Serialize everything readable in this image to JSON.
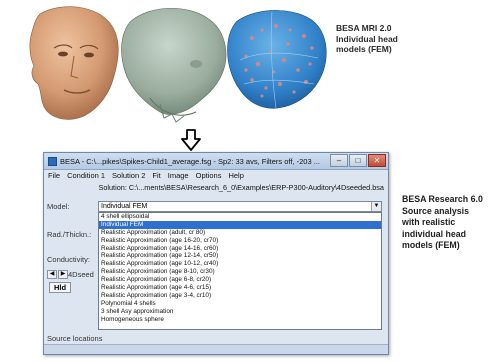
{
  "top_caption": {
    "line1": "BESA MRI 2.0",
    "line2": "Individual head",
    "line3": "models (FEM)"
  },
  "window": {
    "title": "BESA - C:\\...pikes\\Spikes-Child1_average.fsg - Sp2: 33 avs, Filters off, -203 ...",
    "buttons": {
      "minimize": "–",
      "maximize": "□",
      "close": "✕"
    }
  },
  "menu": [
    "File",
    "Condition 1",
    "Solution 2",
    "Fit",
    "Image",
    "Options",
    "Help"
  ],
  "solution_line": "Solution: C:\\...ments\\BESA\\Research_6_0\\Examples\\ERP-P300-Auditory\\4Dseeded.bsa",
  "form": {
    "model_label": "Model:",
    "model_value": "Individual FEM",
    "rad_label": "Rad./Thickn.:",
    "cond_label": "Conductivity:",
    "tab_label": "4Dseed",
    "hld_label": "Hld",
    "source_locations_label": "Source locations"
  },
  "dropdown": {
    "selected_index": 1,
    "options": [
      "4 shell ellipsoidal",
      "Individual FEM",
      "Realistic Approximation (adult, cr 80)",
      "Realistic Approximation (age 16-20, cr70)",
      "Realistic Approximation (age 14-16, cr60)",
      "Realistic Approximation (age 12-14, cr50)",
      "Realistic Approximation (age 10-12, cr40)",
      "Realistic Approximation (age 8-10, cr30)",
      "Realistic Approximation (age 6-8, cr20)",
      "Realistic Approximation (age 4-6, cr15)",
      "Realistic Approximation (age 3-4, cr10)",
      "Polynomial 4 shells",
      "3 shell Asy approximation",
      "Homogeneous sphere"
    ]
  },
  "right_caption": {
    "line1": "BESA Research 6.0",
    "line2": "Source analysis",
    "line3": "with realistic",
    "line4": "individual head",
    "line5": "models (FEM)"
  },
  "colors": {
    "skin": "#d9a67f",
    "skull": "#9fb1a4",
    "brain_mesh": "#3f8fd0",
    "selection": "#2f6fd0"
  },
  "icons": {
    "arrow": "arrow-down-icon",
    "head_models": [
      "head-surface-icon",
      "skull-surface-icon",
      "fem-mesh-icon"
    ]
  }
}
